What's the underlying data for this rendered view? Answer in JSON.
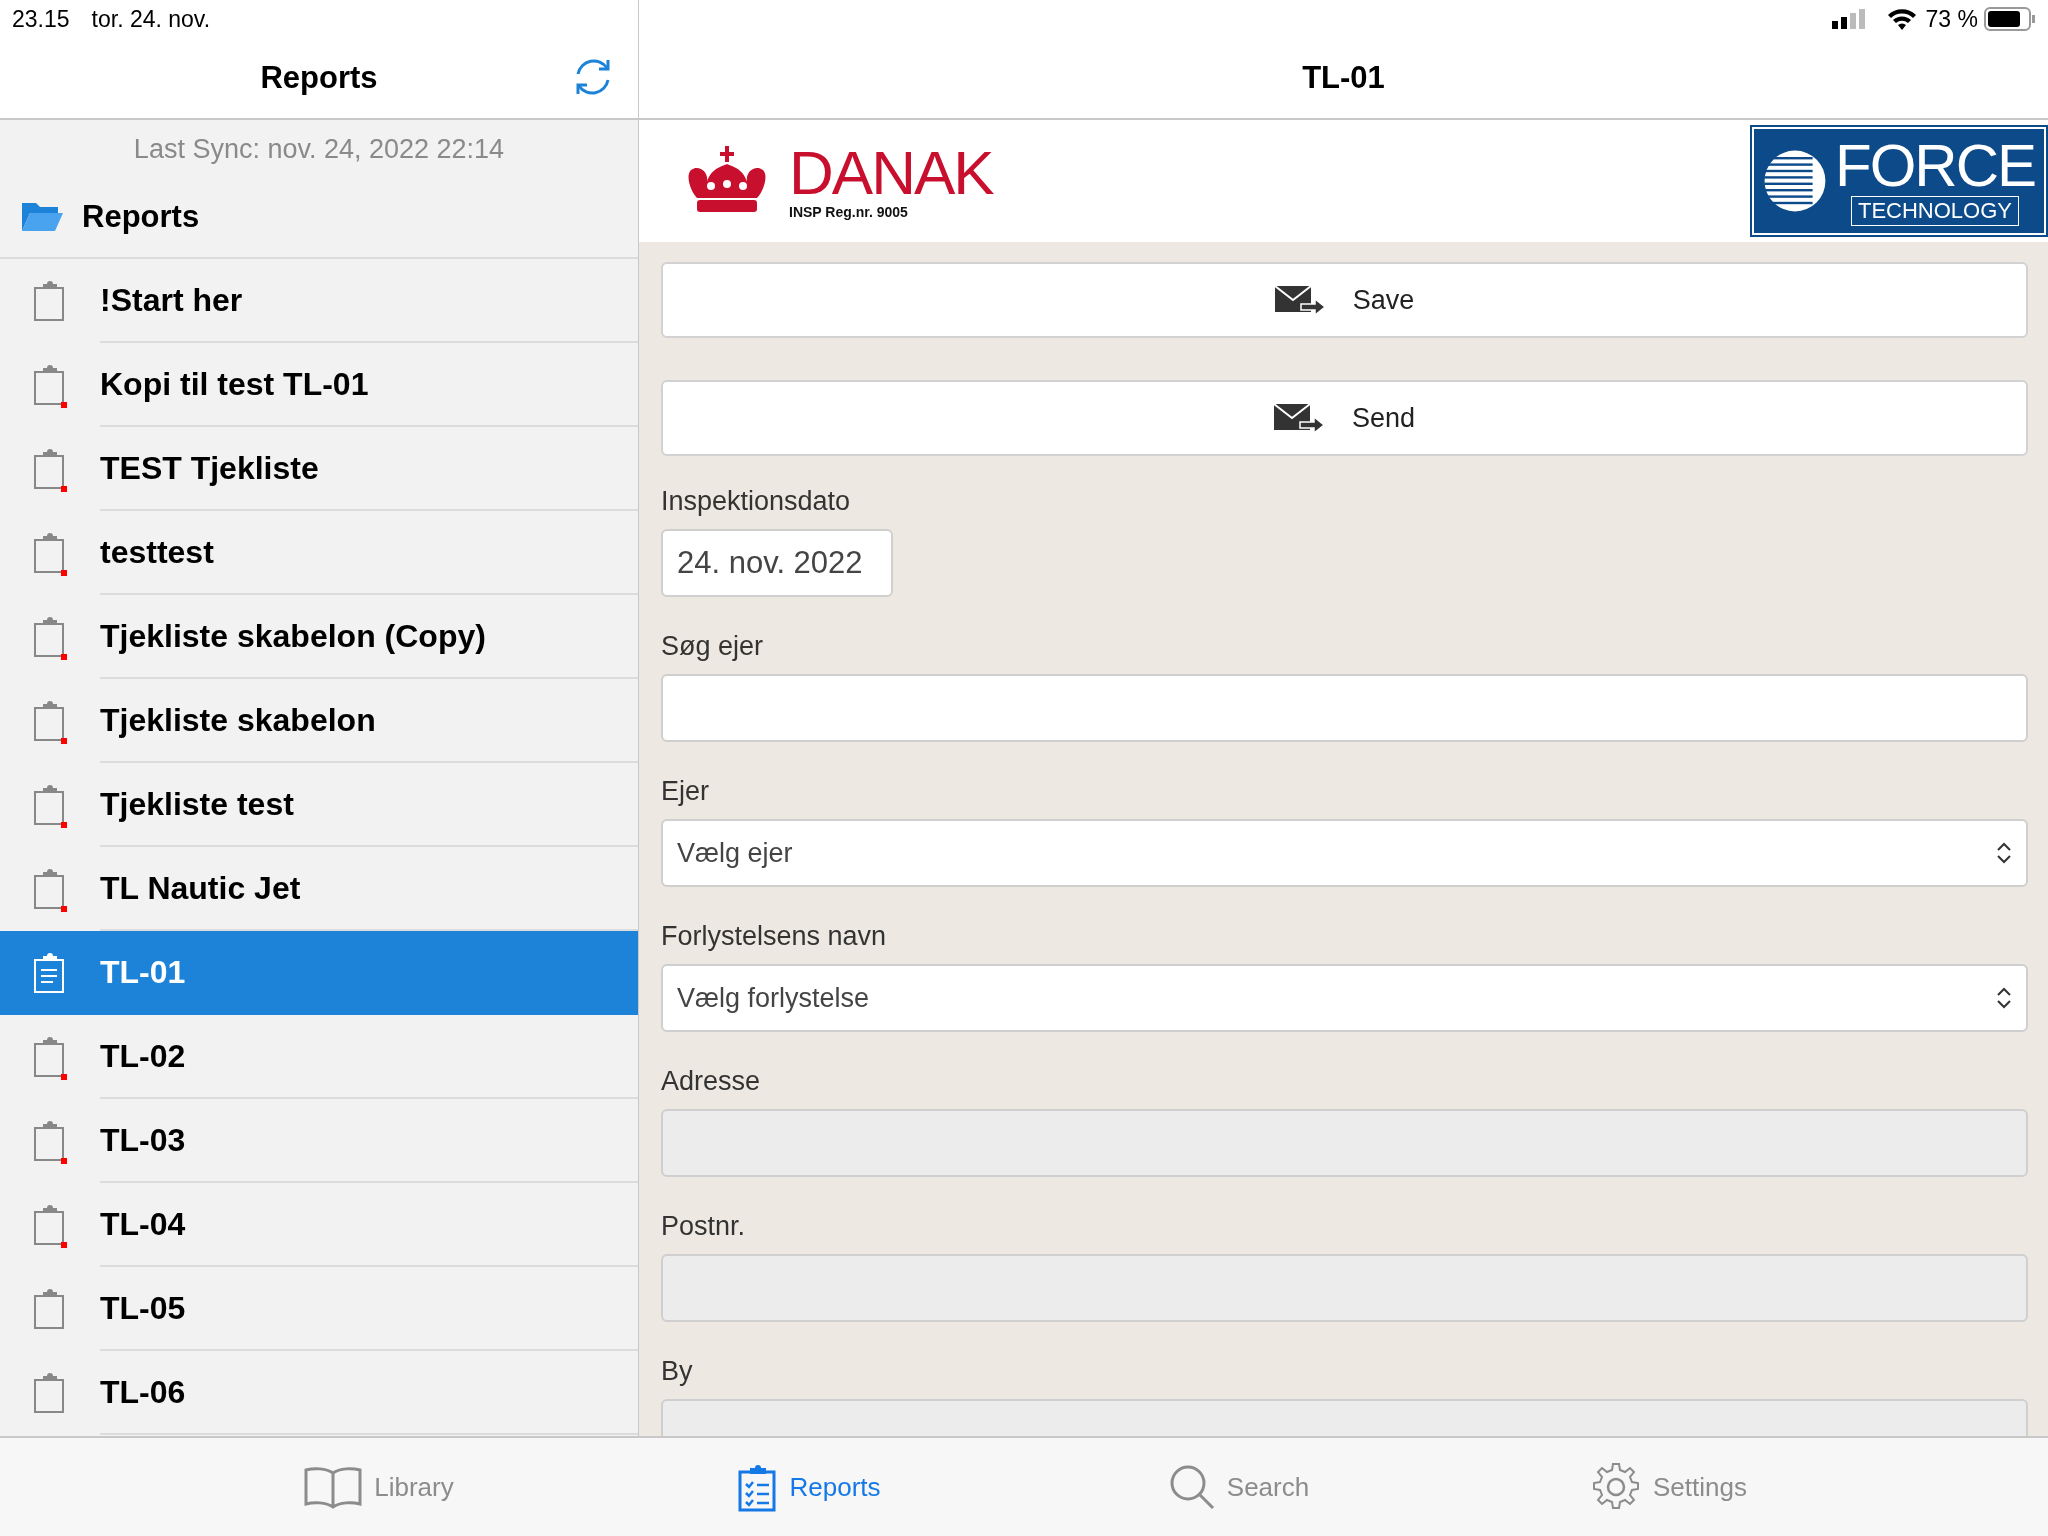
{
  "status_bar": {
    "time": "23.15",
    "date": "tor. 24. nov.",
    "battery": "73 %"
  },
  "sidebar": {
    "title": "Reports",
    "last_sync": "Last Sync: nov. 24, 2022 22:14",
    "folder": "Reports",
    "items": [
      {
        "label": "!Start her",
        "selected": false,
        "flagged": false
      },
      {
        "label": "Kopi til test TL-01",
        "selected": false,
        "flagged": true
      },
      {
        "label": "TEST Tjekliste",
        "selected": false,
        "flagged": true
      },
      {
        "label": "testtest",
        "selected": false,
        "flagged": true
      },
      {
        "label": "Tjekliste skabelon (Copy)",
        "selected": false,
        "flagged": true
      },
      {
        "label": "Tjekliste skabelon",
        "selected": false,
        "flagged": true
      },
      {
        "label": "Tjekliste test",
        "selected": false,
        "flagged": true
      },
      {
        "label": "TL Nautic Jet",
        "selected": false,
        "flagged": true
      },
      {
        "label": "TL-01",
        "selected": true,
        "flagged": false
      },
      {
        "label": "TL-02",
        "selected": false,
        "flagged": true
      },
      {
        "label": "TL-03",
        "selected": false,
        "flagged": true
      },
      {
        "label": "TL-04",
        "selected": false,
        "flagged": true
      },
      {
        "label": "TL-05",
        "selected": false,
        "flagged": false
      },
      {
        "label": "TL-06",
        "selected": false,
        "flagged": false
      }
    ]
  },
  "detail": {
    "title": "TL-01",
    "logos": {
      "danak": "DANAK",
      "danak_reg": "INSP Reg.nr. 9005",
      "force": "FORCE",
      "force_sub": "TECHNOLOGY"
    },
    "buttons": [
      "Save",
      "Send"
    ],
    "fields": [
      {
        "label": "Inspektionsdato",
        "kind": "date",
        "value": "24. nov. 2022"
      },
      {
        "label": "Søg ejer",
        "kind": "text"
      },
      {
        "label": "Ejer",
        "kind": "select",
        "value": "Vælg ejer"
      },
      {
        "label": "Forlystelsens navn",
        "kind": "select",
        "value": "Vælg forlystelse"
      },
      {
        "label": "Adresse",
        "kind": "readonly"
      },
      {
        "label": "Postnr.",
        "kind": "readonly"
      },
      {
        "label": "By",
        "kind": "readonly"
      }
    ]
  },
  "tab_bar": [
    {
      "label": "Library",
      "kind": "book",
      "selected": false
    },
    {
      "label": "Reports",
      "kind": "clipboard",
      "selected": true
    },
    {
      "label": "Search",
      "kind": "search",
      "selected": false
    },
    {
      "label": "Settings",
      "kind": "gear",
      "selected": false
    }
  ]
}
